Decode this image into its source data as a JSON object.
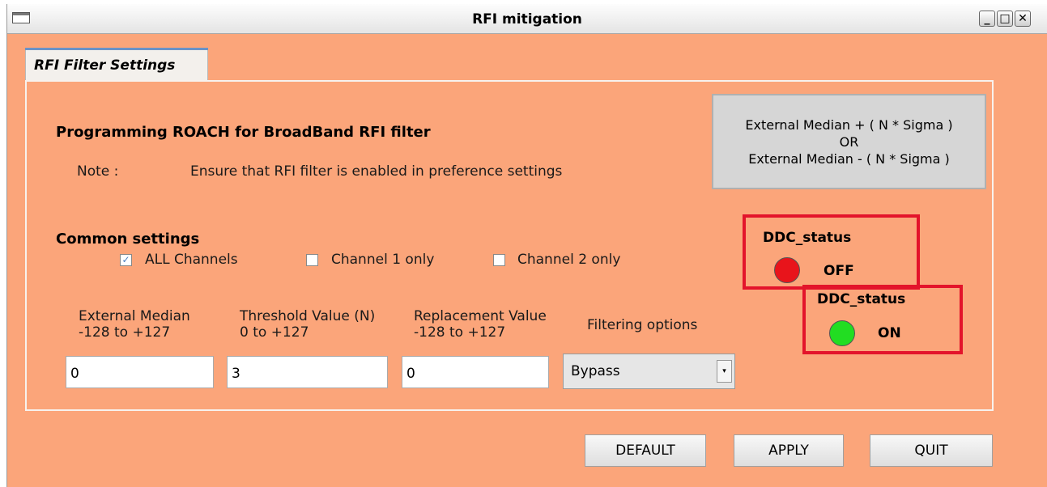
{
  "window": {
    "title": "RFI mitigation"
  },
  "tab": {
    "label": "RFI Filter Settings"
  },
  "programming": {
    "title": "Programming ROACH for BroadBand RFI filter",
    "note_label": "Note :",
    "note_text": "Ensure that RFI filter is enabled in preference settings"
  },
  "formula_button": {
    "line1": "External Median + ( N * Sigma )",
    "line2": "OR",
    "line3": "External Median - ( N * Sigma )"
  },
  "common": {
    "title": "Common settings",
    "options": [
      {
        "label": "ALL Channels",
        "checked": true
      },
      {
        "label": "Channel 1 only",
        "checked": false
      },
      {
        "label": "Channel 2 only",
        "checked": false
      }
    ]
  },
  "fields": {
    "external_median": {
      "label": "External Median",
      "range": "-128 to +127",
      "value": "0"
    },
    "threshold": {
      "label": "Threshold Value (N)",
      "range": "0 to +127",
      "value": "3"
    },
    "replacement": {
      "label": "Replacement Value",
      "range": "-128 to +127",
      "value": "0"
    },
    "filtering": {
      "label": "Filtering options",
      "selected": "Bypass"
    }
  },
  "ddc_off": {
    "title": "DDC_status",
    "value": "OFF",
    "color": "#e8141b"
  },
  "ddc_on": {
    "title": "DDC_status",
    "value": "ON",
    "color": "#22dd22"
  },
  "buttons": {
    "default": "DEFAULT",
    "apply": "APPLY",
    "quit": "QUIT"
  }
}
